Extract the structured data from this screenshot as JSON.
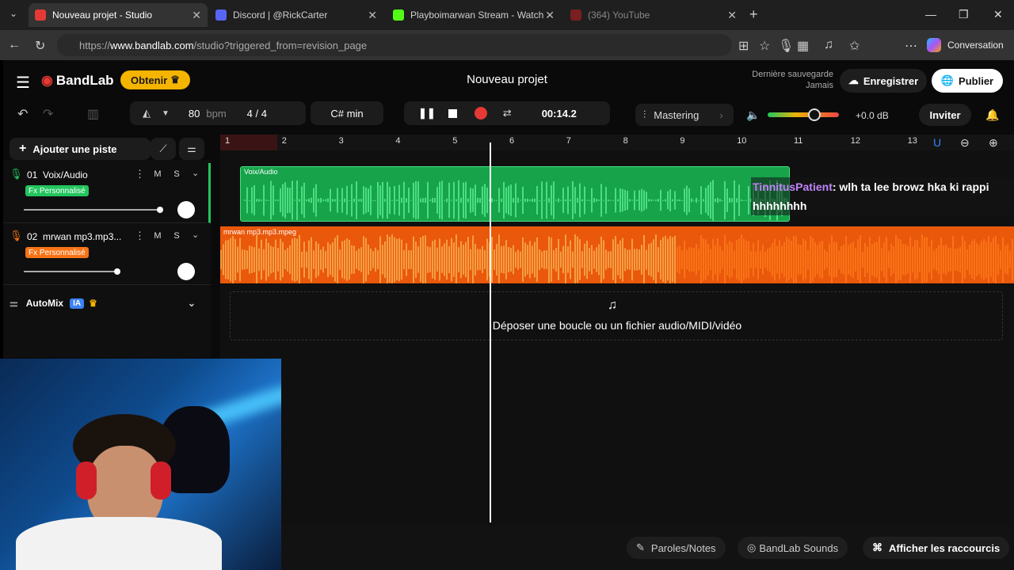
{
  "browser": {
    "tabs": [
      {
        "title": "Nouveau projet - Studio",
        "color": "#e53935",
        "active": true
      },
      {
        "title": "Discord | @RickCarter",
        "color": "#5865f2"
      },
      {
        "title": "Playboimarwan Stream - Watch Li",
        "color": "#53fc18"
      },
      {
        "title": "(364) YouTube",
        "color": "#e53935"
      }
    ],
    "url_prefix": "https://",
    "url_host": "www.bandlab.com",
    "url_path": "/studio?triggered_from=revision_page",
    "conversation_label": "Conversation"
  },
  "header": {
    "logo": "BandLab",
    "obtain_label": "Obtenir",
    "project_title": "Nouveau projet",
    "last_saved_label": "Dernière sauvegarde",
    "last_saved_value": "Jamais",
    "save_label": "Enregistrer",
    "publish_label": "Publier"
  },
  "toolbar": {
    "bpm_value": "80",
    "bpm_unit": "bpm",
    "time_sig_num": "4",
    "time_sig_den": "4",
    "key": "C# min",
    "time": "00:14.2",
    "mastering": "Mastering",
    "volume_db": "+0.0 dB",
    "invite_label": "Inviter"
  },
  "sidebar": {
    "add_track_label": "Ajouter une piste",
    "tracks": [
      {
        "number": "01",
        "name": "Voix/Audio",
        "fx": "Fx Personnalisé",
        "color": "#22c55e"
      },
      {
        "number": "02",
        "name": "mrwan mp3.mp3...",
        "fx": "Fx Personnalisé",
        "color": "#f97316"
      }
    ],
    "automix_label": "AutoMix",
    "ia_badge": "IA"
  },
  "ruler": {
    "marks": [
      "1",
      "2",
      "3",
      "4",
      "5",
      "6",
      "7",
      "8",
      "9",
      "10",
      "11",
      "12",
      "13"
    ]
  },
  "clips": {
    "vocal_name": "Voix/Audio",
    "beat_name": "mrwan mp3.mp3.mpeg"
  },
  "chat": {
    "user": "TinnitusPatient",
    "message": ": wlh ta lee browz hka ki rappi hhhhhhhh"
  },
  "drop_zone": {
    "label": "Déposer une boucle ou un fichier audio/MIDI/vidéo"
  },
  "bottom": {
    "lyrics_label": "Paroles/Notes",
    "sounds_label": "BandLab Sounds",
    "shortcuts_label": "Afficher les raccourcis"
  }
}
